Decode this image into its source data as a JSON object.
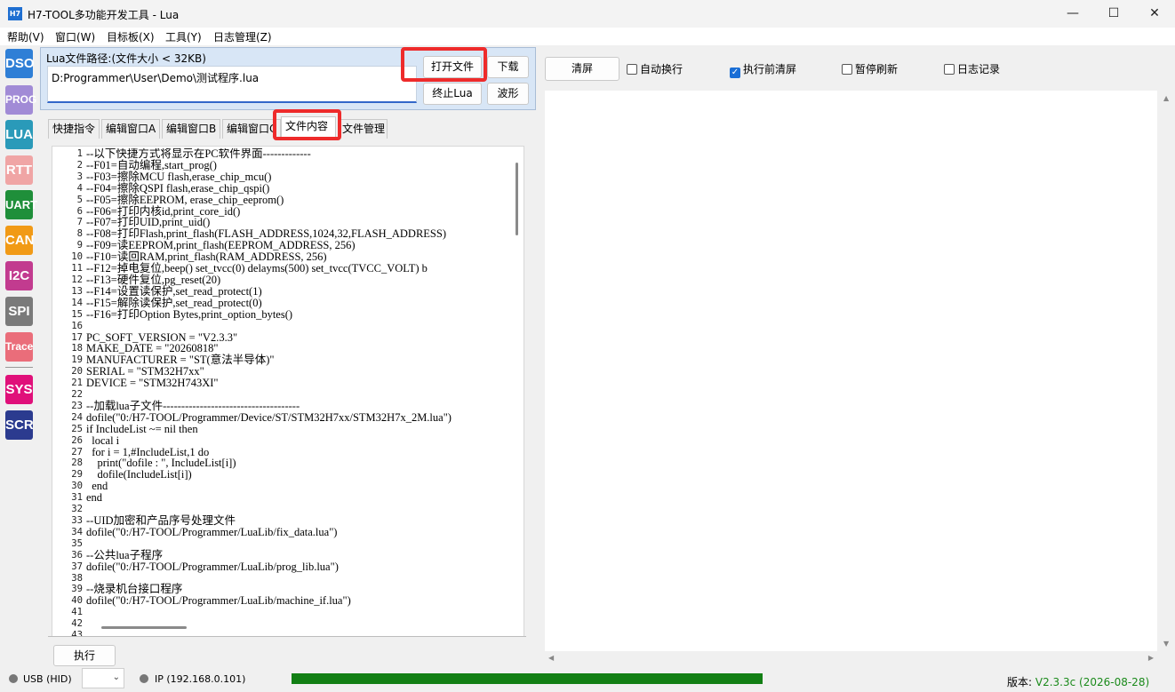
{
  "window": {
    "title": "H7-TOOL多功能开发工具 - Lua",
    "icon": "H7",
    "controls": [
      "minimize-icon",
      "maximize-icon",
      "close-icon"
    ]
  },
  "menu": [
    "帮助(V)",
    "窗口(W)",
    "目标板(X)",
    "工具(Y)",
    "日志管理(Z)"
  ],
  "sidebar": [
    {
      "label": "DSO",
      "color": "#2f7fd6"
    },
    {
      "label": "PROG",
      "color": "#a18bd6"
    },
    {
      "label": "LUA",
      "color": "#2a9ab9"
    },
    {
      "label": "RTT",
      "color": "#f0a5a5"
    },
    {
      "label": "UART",
      "color": "#1f8f3a"
    },
    {
      "label": "CAN",
      "color": "#f19a16"
    },
    {
      "label": "I2C",
      "color": "#c23b8f"
    },
    {
      "label": "SPI",
      "color": "#7a7a7a"
    },
    {
      "label": "Trace",
      "color": "#ea6d7a"
    },
    {
      "label": "SYS",
      "color": "#e0107a"
    },
    {
      "label": "SCR",
      "color": "#2b3b8f"
    }
  ],
  "path": {
    "label": "Lua文件路径:(文件大小 < 32KB)",
    "value": "D:Programmer\\User\\Demo\\测试程序.lua"
  },
  "buttons": {
    "open": "打开文件",
    "download": "下载",
    "stop": "终止Lua",
    "wave": "波形",
    "execute": "执行",
    "clear": "清屏"
  },
  "tabs": [
    "快捷指令",
    "编辑窗口A",
    "编辑窗口B",
    "编辑窗口C",
    "文件内容",
    "文件管理"
  ],
  "active_tab": "文件内容",
  "editor": {
    "lines": [
      "--以下快捷方式将显示在PC软件界面-------------",
      "--F01=自动编程,start_prog()",
      "--F03=擦除MCU flash,erase_chip_mcu()",
      "--F04=擦除QSPI flash,erase_chip_qspi()",
      "--F05=擦除EEPROM, erase_chip_eeprom()",
      "--F06=打印内核id,print_core_id()",
      "--F07=打印UID,print_uid()",
      "--F08=打印Flash,print_flash(FLASH_ADDRESS,1024,32,FLASH_ADDRESS)",
      "--F09=读EEPROM,print_flash(EEPROM_ADDRESS, 256)",
      "--F10=读回RAM,print_flash(RAM_ADDRESS, 256)",
      "--F12=掉电复位,beep() set_tvcc(0) delayms(500) set_tvcc(TVCC_VOLT) b",
      "--F13=硬件复位,pg_reset(20)",
      "--F14=设置读保护,set_read_protect(1)",
      "--F15=解除读保护,set_read_protect(0)",
      "--F16=打印Option Bytes,print_option_bytes()",
      "",
      "PC_SOFT_VERSION = \"V2.3.3\"",
      "MAKE_DATE = \"20260818\"",
      "MANUFACTURER = \"ST(意法半导体)\"",
      "SERIAL = \"STM32H7xx\"",
      "DEVICE = \"STM32H743XI\"",
      "",
      "--加载lua子文件-------------------------------------",
      "dofile(\"0:/H7-TOOL/Programmer/Device/ST/STM32H7xx/STM32H7x_2M.lua\")",
      "if IncludeList ~= nil then",
      "  local i",
      "  for i = 1,#IncludeList,1 do",
      "    print(\"dofile : \", IncludeList[i])",
      "    dofile(IncludeList[i])",
      "  end",
      "end",
      "",
      "--UID加密和产品序号处理文件",
      "dofile(\"0:/H7-TOOL/Programmer/LuaLib/fix_data.lua\")",
      "",
      "--公共lua子程序",
      "dofile(\"0:/H7-TOOL/Programmer/LuaLib/prog_lib.lua\")",
      "",
      "--烧录机台接口程序",
      "dofile(\"0:/H7-TOOL/Programmer/LuaLib/machine_if.lua\")",
      "",
      "",
      ""
    ]
  },
  "options": [
    {
      "label": "自动换行",
      "checked": false
    },
    {
      "label": "执行前清屏",
      "checked": true
    },
    {
      "label": "暂停刷新",
      "checked": false
    },
    {
      "label": "日志记录",
      "checked": false
    }
  ],
  "status": {
    "usb": "USB (HID)",
    "ip": "IP (192.168.0.101)",
    "progress": 0.98,
    "version_label": "版本:",
    "version_value": "V2.3.3c (2026-08-28)",
    "version_color": "#1a8a1a",
    "progress_color": "#127f14"
  }
}
